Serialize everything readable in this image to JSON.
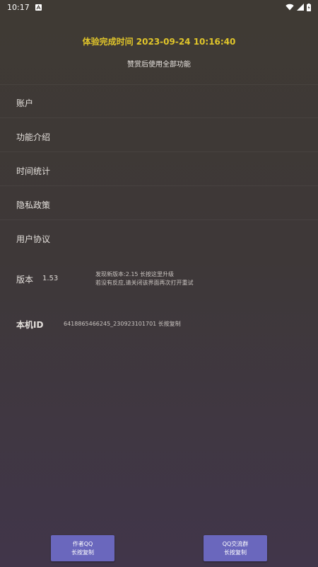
{
  "status_bar": {
    "time": "10:17",
    "icons": [
      "notification-a-icon",
      "wifi-icon",
      "signal-icon",
      "battery-icon"
    ]
  },
  "header": {
    "expire_text": "体验完成时间 2023-09-24 10:16:40",
    "subtitle": "赞赏后使用全部功能"
  },
  "menu": {
    "account": "账户",
    "features": "功能介绍",
    "time_stats": "时间统计",
    "privacy": "隐私政策",
    "user_agreement": "用户协议"
  },
  "version": {
    "label": "版本",
    "number": "1.53",
    "update_line1": "发现新版本:2.15 长按这里升级",
    "update_line2": "若没有反应,请关闭该界面再次打开重试"
  },
  "device": {
    "label": "本机ID",
    "value": "6418865466245_230923101701  长按复制"
  },
  "buttons": {
    "author_title": "作者QQ",
    "author_hint": "长按复制",
    "group_title": "QQ交流群",
    "group_hint": "长按复制"
  },
  "colors": {
    "accent_yellow": "#e0c52a",
    "button_bg": "#6a67bd"
  }
}
